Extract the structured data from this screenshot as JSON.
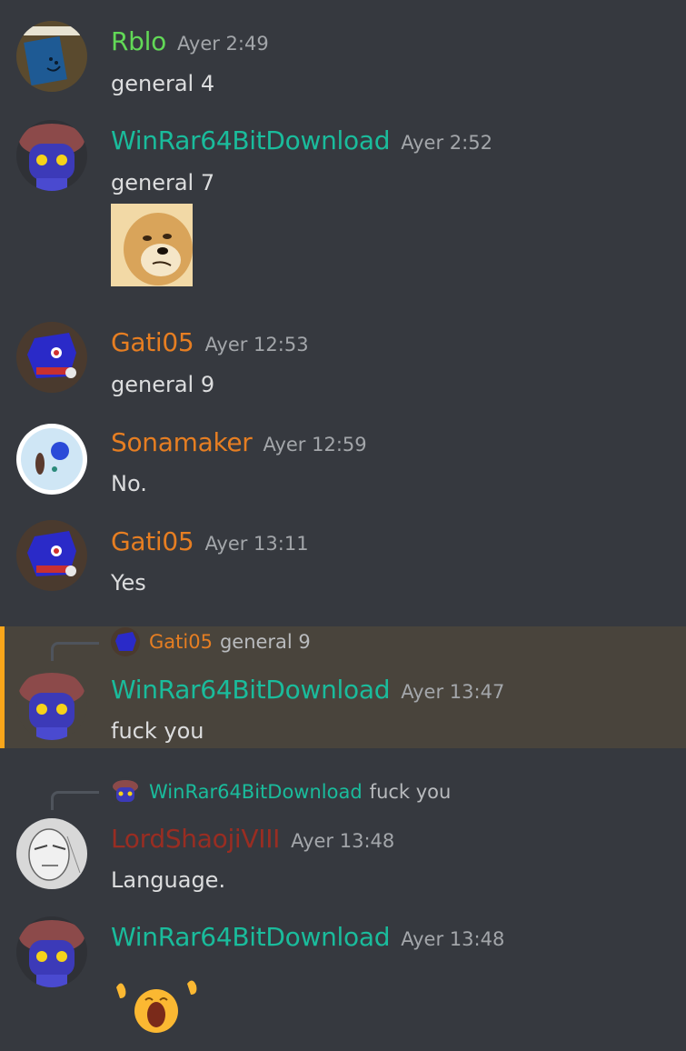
{
  "colors": {
    "rblo": "#62d957",
    "winrar": "#1abc9c",
    "gati": "#e67e22",
    "sona": "#e67e22",
    "lord": "#992d22",
    "mention_bg": "#49443c",
    "mention_bar": "#faa61a"
  },
  "messages": [
    {
      "user": "Rblo",
      "time": "Ayer 2:49",
      "text": "general 4"
    },
    {
      "user": "WinRar64BitDownload",
      "time": "Ayer 2:52",
      "text": "general 7"
    },
    {
      "user": "Gati05",
      "time": "Ayer 12:53",
      "text": "general 9"
    },
    {
      "user": "Sonamaker",
      "time": "Ayer 12:59",
      "text": "No."
    },
    {
      "user": "Gati05",
      "time": "Ayer 13:11",
      "text": "Yes"
    },
    {
      "user": "WinRar64BitDownload",
      "time": "Ayer 13:47",
      "text": "fuck you",
      "reply": {
        "user": "Gati05",
        "text": "general 9"
      }
    },
    {
      "user": "LordShaojiVIII",
      "time": "Ayer 13:48",
      "text": "Language.",
      "reply": {
        "user": "WinRar64BitDownload",
        "text": "fuck you"
      }
    },
    {
      "user": "WinRar64BitDownload",
      "time": "Ayer 13:48",
      "text": ""
    }
  ],
  "icons": {
    "doge": "doge-image",
    "reaction": "screaming-face-emoji"
  }
}
